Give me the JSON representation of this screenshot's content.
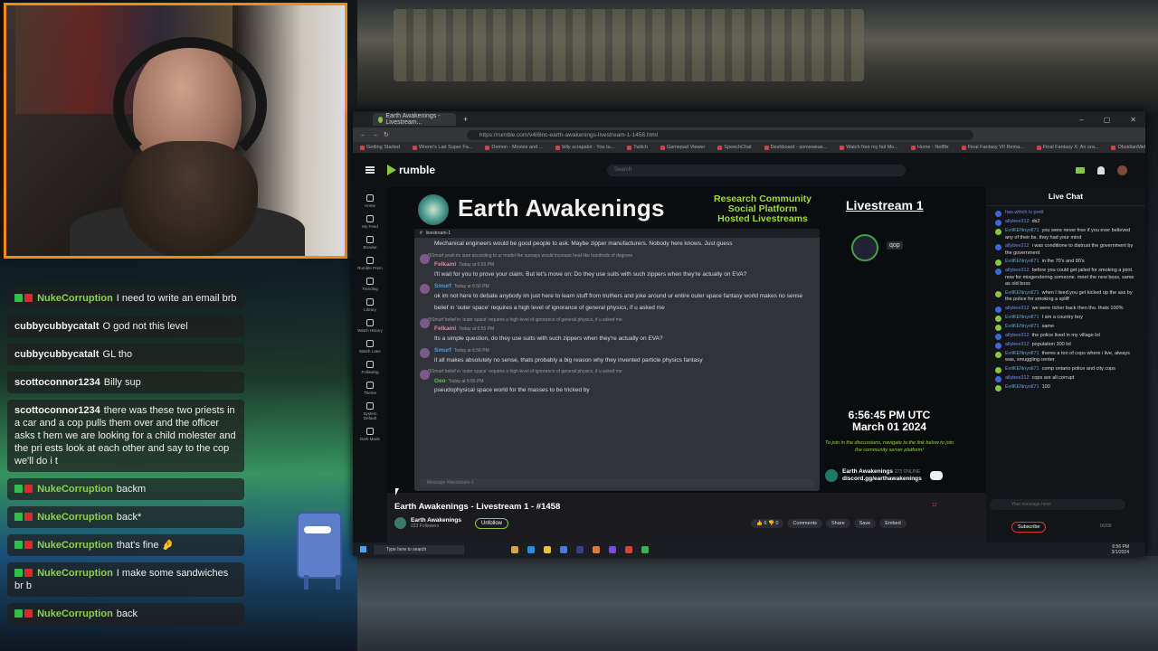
{
  "chat": {
    "messages": [
      {
        "user": "NukeCorruption",
        "text": "I need to write an email brb",
        "badges": true
      },
      {
        "user": "cubbycubbycatalt",
        "text": "O god not this level",
        "badges": false
      },
      {
        "user": "cubbycubbycatalt",
        "text": "GL tho",
        "badges": false
      },
      {
        "user": "scottoconnor1234",
        "text": "Billy sup",
        "badges": false
      },
      {
        "user": "scottoconnor1234",
        "text": "there was these two priests in a car and a cop pulls them over and the officer asks t hem we are looking for a child molester and the pri ests look at each other and say to the cop we'll do i t",
        "badges": false
      },
      {
        "user": "NukeCorruption",
        "text": "backm",
        "badges": true
      },
      {
        "user": "NukeCorruption",
        "text": "back*",
        "badges": true
      },
      {
        "user": "NukeCorruption",
        "text": "that's fine 🤌",
        "badges": true
      },
      {
        "user": "NukeCorruption",
        "text": "I make some sandwiches br b",
        "badges": true
      },
      {
        "user": "NukeCorruption",
        "text": "back",
        "badges": true
      }
    ]
  },
  "browser": {
    "tab_title": "Earth Awakenings - Livestream...",
    "url": "https://rumble.com/v4i6lnc-earth-awakenings-livestream-1-1458.html",
    "bookmarks": [
      "Getting Started",
      "Wrenn's Lair Super Fa...",
      "Demon - Movies and ...",
      "billy scrapalot - You tu...",
      "Twitch",
      "Gamepad Viewer",
      "SpeechChat",
      "Dashboard - someweas...",
      "Watch free my fail Mo...",
      "Home - Netflix",
      "Final Fantasy VII Rema...",
      "Final Fantasy X: An ora...",
      "ObsidianMelon - Hobb..."
    ]
  },
  "rumble": {
    "logo": "rumble",
    "search_placeholder": "Search",
    "nav": [
      "Home",
      "My Feed",
      "Browse",
      "Rumble Prem",
      "Trending",
      "Library",
      "Watch History",
      "Watch Later",
      "Following",
      "Theme",
      "System Default",
      "Dark Mode"
    ],
    "video_title": "Earth Awakenings - Livestream 1 - #1458",
    "channel_name": "Earth Awakenings",
    "followers": "223 Followers",
    "unfollow": "Unfollow",
    "likes": "6",
    "dislikes": "0",
    "comments": "Comments",
    "share": "Share",
    "save": "Save",
    "embed": "Embed",
    "viewers": "12"
  },
  "overlay": {
    "title": "Earth Awakenings",
    "subtitle_1": "Research Community",
    "subtitle_2": "Social Platform",
    "subtitle_3": "Hosted Livestreams",
    "livestream": "Livestream 1",
    "qop": "qop",
    "time": "6:56:45 PM UTC",
    "date": "March 01 2024",
    "join_text": "To join in the discussions, navigate to the link below to join the community server platform!",
    "discord_name": "Earth Awakenings",
    "discord_online": "273 ONLINE",
    "discord_link": "discord.gg/earthawakenings"
  },
  "discord": {
    "channel": "livestream-1",
    "messages": [
      {
        "name": "",
        "color": "",
        "reply": "",
        "text": "Mechanical engineers would be good people to ask. Maybe zipper manufacturers. Nobody here knows. Just guess"
      },
      {
        "name": "Felkami",
        "color": "pink",
        "time": "Today at 6:50 PM",
        "reply": "@Smurf yeah im sure according to ur model the sunrays would increase heat like hundreds of degrees",
        "text": "I'll wait for you to prove your claim. But let's move on: Do they use suits with such zippers when they're actually on EVA?"
      },
      {
        "name": "Smurf",
        "color": "blue",
        "time": "Today at 6:50 PM",
        "reply": "",
        "text": "ok im not here to debate anybody im just here to learn stuff from truthers and joke around ur entire outer space fantasy world makes no sense"
      },
      {
        "name": "",
        "color": "",
        "reply": "",
        "text": "belief in 'outer space' requires a high level of ignorance of general physics, if u asked me"
      },
      {
        "name": "Felkami",
        "color": "pink",
        "time": "Today at 6:55 PM",
        "reply": "@Smurf belief in 'outer space' requires a high level of ignorance of general physics, if u asked me",
        "text": "Its a simple question, do they use suits with such zippers when they're actually on EVA?"
      },
      {
        "name": "Smurf",
        "color": "blue",
        "time": "Today at 6:56 PM",
        "reply": "",
        "text": "it all makes absolutely no sense, thats probably a big reason why they invented particle physics fantasy"
      },
      {
        "name": "Geo",
        "color": "green",
        "time": "Today at 6:55 PM",
        "reply": "@Smurf belief in 'outer space' requires a high level of ignorance of general physics, if u asked me",
        "text": "pseudophysical space world for the masses to be tricked by"
      }
    ],
    "input_placeholder": "Message #livestream-1"
  },
  "live_chat": {
    "title": "Live Chat",
    "messages": [
      {
        "user": "has.which is prett",
        "text": "",
        "g": false
      },
      {
        "user": "allybee312",
        "text": "ds2",
        "g": false
      },
      {
        "user": "EvilKENnyoll71",
        "text": "you were never free if you ever believed any of their bs. they had your mind",
        "g": true
      },
      {
        "user": "allybee312",
        "text": "i was conditione to distrust the government by the government",
        "g": false
      },
      {
        "user": "EvilKENnyoll71",
        "text": "in the 70's and 80's",
        "g": true
      },
      {
        "user": "allybee312",
        "text": "before you could get jailed for smoking a joint. now for misgendering someone. meet the new boss, same as old boss",
        "g": false
      },
      {
        "user": "EvilKENnyoll71",
        "text": "when I lived.you get kicked up the ass by the police for smoking a spliff",
        "g": true
      },
      {
        "user": "allybee312",
        "text": "we were richer back then tho. thats 100%",
        "g": false
      },
      {
        "user": "EvilKENnyoll71",
        "text": "I am a country boy",
        "g": true
      },
      {
        "user": "EvilKENnyoll71",
        "text": "same",
        "g": true
      },
      {
        "user": "allybee312",
        "text": "the police lived in my village lol",
        "g": false
      },
      {
        "user": "allybee312",
        "text": "population 300 lol",
        "g": false
      },
      {
        "user": "EvilKENnyoll71",
        "text": "theres a ton of cops where i live, always was, smuggling center",
        "g": true
      },
      {
        "user": "EvilKENnyoll71",
        "text": "comp ontario police and city cops",
        "g": true
      },
      {
        "user": "allybee312",
        "text": "cops are all corrupt",
        "g": false
      },
      {
        "user": "EvilKENnyoll71",
        "text": "100",
        "g": true
      }
    ],
    "input_placeholder": "Your message here",
    "subscribe": "Subscribe",
    "counter": "0/200"
  },
  "taskbar": {
    "search": "Type here to search",
    "time": "6:56 PM",
    "date": "3/1/2024"
  }
}
